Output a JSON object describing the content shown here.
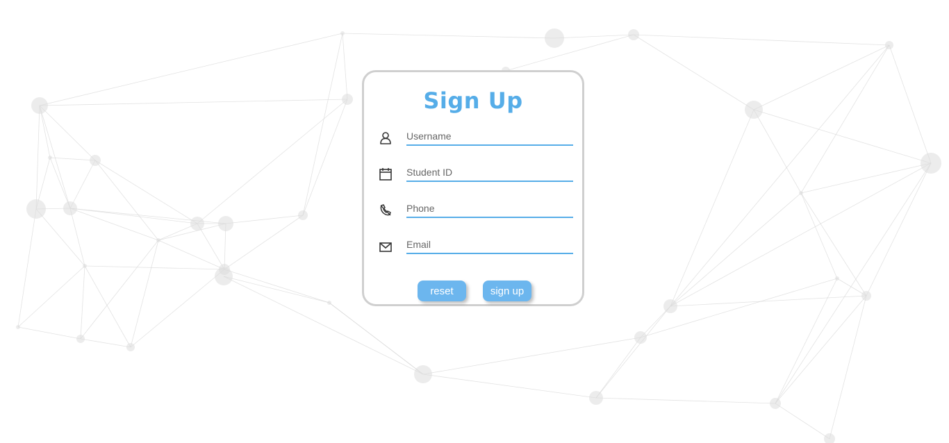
{
  "form": {
    "title": "Sign Up",
    "fields": [
      {
        "icon": "user-icon",
        "placeholder": "Username"
      },
      {
        "icon": "calendar-icon",
        "placeholder": "Student ID"
      },
      {
        "icon": "phone-icon",
        "placeholder": "Phone"
      },
      {
        "icon": "mail-icon",
        "placeholder": "Email"
      }
    ],
    "reset_label": "reset",
    "signup_label": "sign up"
  },
  "colors": {
    "accent": "#56ade8",
    "button": "#6cb6ee",
    "card_border": "#cfcfcf"
  }
}
